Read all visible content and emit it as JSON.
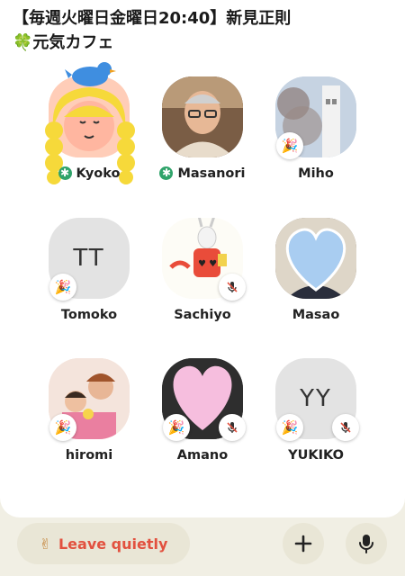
{
  "room": {
    "title_line1": "【毎週火曜日金曜日20:40】新見正則",
    "title_line2": "元気カフェ",
    "title_icon": "four-leaf-clover"
  },
  "speakers": [
    {
      "name": "Kyoko",
      "moderator": true,
      "badge": "none",
      "avatar": "cartoon-girl-with-bird"
    },
    {
      "name": "Masanori",
      "moderator": true,
      "badge": "none",
      "avatar": "man-photo"
    },
    {
      "name": "Miho",
      "moderator": false,
      "badge": "party-popper",
      "avatar": "cherry-blossom-tower-photo"
    },
    {
      "name": "Tomoko",
      "initials": "TT",
      "moderator": false,
      "badge": "party-popper",
      "avatar": "initials"
    },
    {
      "name": "Sachiyo",
      "moderator": false,
      "badge": "muted-mic",
      "avatar": "white-rabbit-illustration"
    },
    {
      "name": "Masao",
      "moderator": false,
      "badge": "none",
      "avatar": "blue-heart-over-photo"
    },
    {
      "name": "hiromi",
      "moderator": false,
      "badge": "party-popper",
      "avatar": "family-photo"
    },
    {
      "name": "Amano",
      "moderator": false,
      "badge": "party-popper+muted-mic",
      "avatar": "pink-heart-over-photo"
    },
    {
      "name": "YUKIKO",
      "initials": "YY",
      "moderator": false,
      "badge": "party-popper+muted-mic",
      "avatar": "initials"
    }
  ],
  "controls": {
    "leave_label": "Leave quietly",
    "leave_icon": "victory-hand",
    "add_icon": "plus-icon",
    "mic_icon": "microphone-icon"
  },
  "colors": {
    "leave_text": "#e2513f",
    "moderator_badge": "#2fa36a",
    "background": "#f1efe4"
  }
}
